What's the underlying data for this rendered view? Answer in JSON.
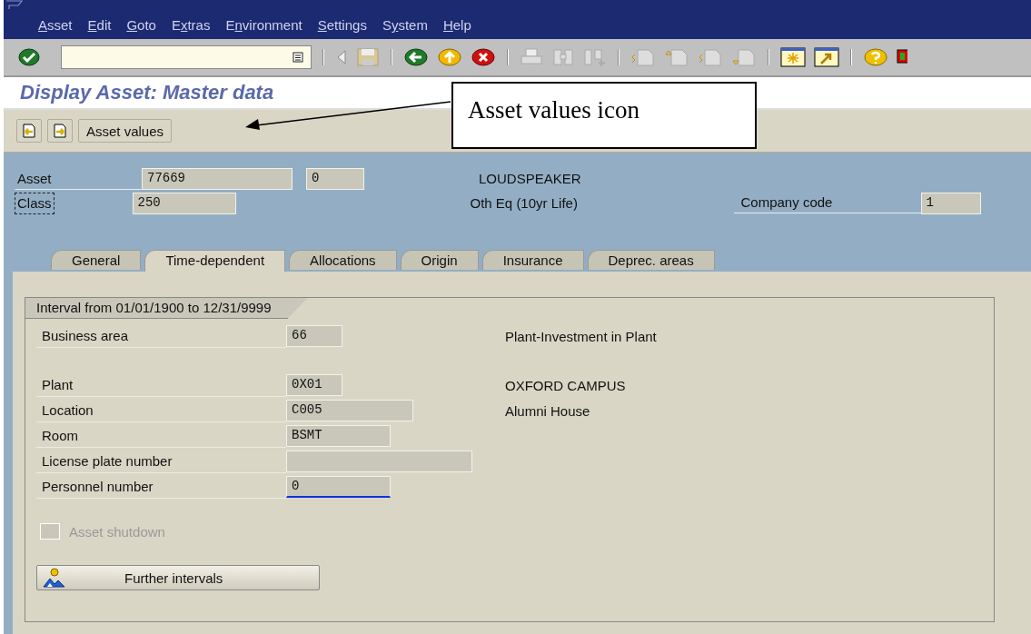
{
  "menu": [
    {
      "key": "A",
      "post": "sset"
    },
    {
      "key": "E",
      "post": "dit"
    },
    {
      "key": "G",
      "post": "oto"
    },
    {
      "pre": "E",
      "key": "x",
      "post": "tras"
    },
    {
      "pre": "E",
      "key": "n",
      "post": "vironment"
    },
    {
      "key": "S",
      "post": "ettings"
    },
    {
      "pre": "S",
      "key": "y",
      "post": "stem"
    },
    {
      "key": "H",
      "post": "elp"
    }
  ],
  "title": "Display Asset:  Master data",
  "app_toolbar": {
    "button": "Asset values"
  },
  "callout": {
    "text": "Asset values icon"
  },
  "header": {
    "asset": {
      "label": "Asset",
      "value": "77669",
      "sub_number": "0",
      "description": "LOUDSPEAKER"
    },
    "class": {
      "label": "Class",
      "focused": true,
      "value": "250",
      "description": "Oth Eq (10yr Life)"
    },
    "company_code": {
      "label": "Company code",
      "value": "1"
    }
  },
  "tabs": [
    {
      "label": "General",
      "selected": false
    },
    {
      "label": "Time-dependent",
      "selected": true
    },
    {
      "label": "Allocations",
      "selected": false
    },
    {
      "label": "Origin",
      "selected": false
    },
    {
      "label": "Insurance",
      "selected": false
    },
    {
      "label": "Deprec. areas",
      "selected": false
    }
  ],
  "interval": {
    "title": "Interval from 01/01/1900 to 12/31/9999",
    "field_groups": [
      [
        {
          "label": "Business area",
          "value": "66",
          "description": "Plant-Investment in Plant",
          "focused": false
        }
      ],
      [
        {
          "label": "Plant",
          "value": "0X01",
          "description": "OXFORD CAMPUS",
          "focused": false
        },
        {
          "label": "Location",
          "value": "C005",
          "description": "Alumni House",
          "focused": false
        },
        {
          "label": "Room",
          "value": "BSMT",
          "focused": false
        },
        {
          "label": "License plate number",
          "focused": false
        },
        {
          "label": "Personnel number",
          "value": "0",
          "focused": true
        }
      ]
    ],
    "checkbox": {
      "label": "Asset shutdown",
      "checked": false,
      "disabled": true
    },
    "button": "Further intervals"
  }
}
